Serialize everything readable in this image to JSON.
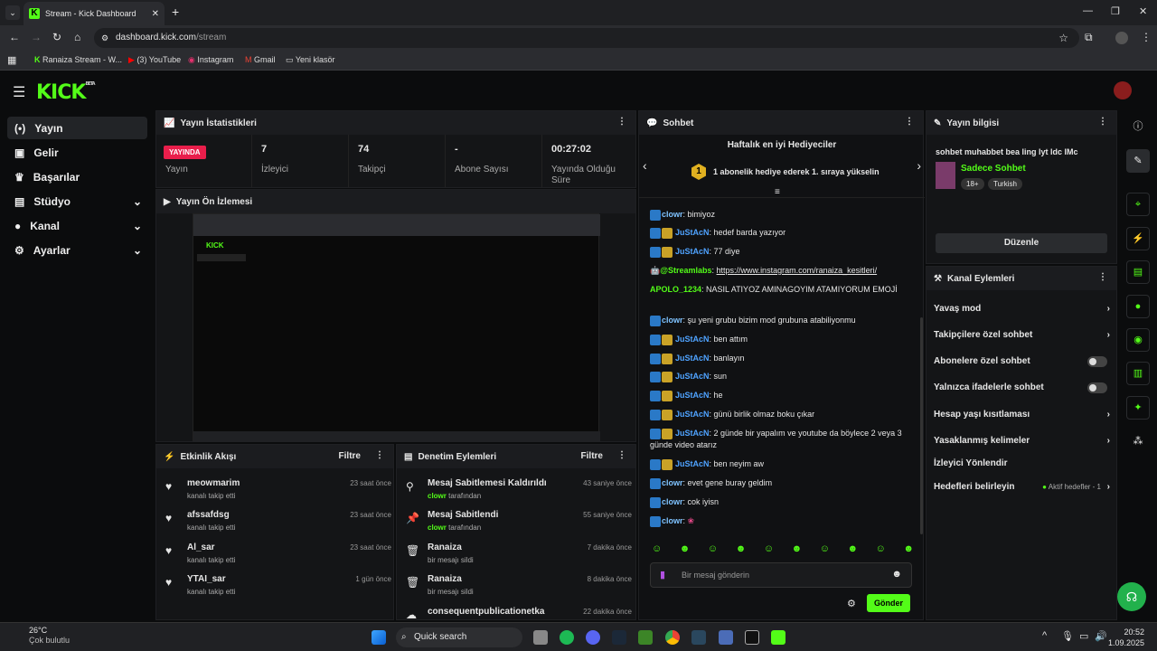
{
  "browser": {
    "tab_title": "Stream - Kick Dashboard",
    "url_host": "dashboard.kick.com",
    "url_path": "/stream",
    "bookmarks": [
      "Ranaiza Stream - W...",
      "(3) YouTube",
      "Instagram",
      "Gmail",
      "Yeni klasör"
    ]
  },
  "brand": {
    "logo": "KICK",
    "beta": "BETA"
  },
  "sidebar": {
    "items": [
      {
        "label": "Yayın"
      },
      {
        "label": "Gelir"
      },
      {
        "label": "Başarılar"
      },
      {
        "label": "Stüdyo"
      },
      {
        "label": "Kanal"
      },
      {
        "label": "Ayarlar"
      }
    ]
  },
  "stats": {
    "title": "Yayın İstatistikleri",
    "live_badge": "YAYINDA",
    "live_label": "Yayın",
    "items": [
      {
        "value": "7",
        "label": "İzleyici"
      },
      {
        "value": "74",
        "label": "Takipçi"
      },
      {
        "value": "-",
        "label": "Abone Sayısı"
      },
      {
        "value": "00:27:02",
        "label": "Yayında Olduğu Süre"
      }
    ]
  },
  "preview": {
    "title": "Yayın Ön İzlemesi"
  },
  "activity": {
    "title": "Etkinlik Akışı",
    "filter": "Filtre",
    "events": [
      {
        "name": "meowmarim",
        "sub": "kanalı takip etti",
        "time": "23 saat önce"
      },
      {
        "name": "afssafdsg",
        "sub": "kanalı takip etti",
        "time": "23 saat önce"
      },
      {
        "name": "Al_sar",
        "sub": "kanalı takip etti",
        "time": "23 saat önce"
      },
      {
        "name": "YTAI_sar",
        "sub": "kanalı takip etti",
        "time": "1 gün önce"
      }
    ]
  },
  "moderation": {
    "title": "Denetim Eylemleri",
    "filter": "Filtre",
    "events": [
      {
        "name": "Mesaj Sabitlemesi Kaldırıldı",
        "user": "clowr",
        "suffix": "tarafından",
        "time": "43 saniye önce"
      },
      {
        "name": "Mesaj Sabitlendi",
        "user": "clowr",
        "suffix": "tarafından",
        "time": "55 saniye önce"
      },
      {
        "name": "Ranaiza",
        "user": "",
        "suffix": "bir mesajı sildi",
        "time": "7 dakika önce"
      },
      {
        "name": "Ranaiza",
        "user": "",
        "suffix": "bir mesajı sildi",
        "time": "8 dakika önce"
      },
      {
        "name": "consequentpublicationetka",
        "user": "",
        "suffix": "",
        "time": "22 dakika önce"
      }
    ]
  },
  "chat": {
    "title": "Sohbet",
    "gifter_title": "Haftalık en iyi Hediyeciler",
    "gifter_rank": "1",
    "gifter_text": "1 abonelik hediye ederek 1. sıraya yükselin",
    "messages": [
      {
        "user": "clowr",
        "text": "bimiyoz"
      },
      {
        "user": "JuStAcN",
        "text": "hedef barda yazıyor"
      },
      {
        "user": "JuStAcN",
        "text": "77 diye"
      },
      {
        "user": "@Streamlabs",
        "text": "https://www.instagram.com/ranaiza_kesitleri/"
      },
      {
        "user": "APOLO_1234",
        "text": "NASIL ATIYOZ AMINAGOYIM ATAMIYORUM EMOJİ"
      },
      {
        "user": "clowr",
        "text": "şu yeni grubu bizim mod grubuna atabiliyonmu"
      },
      {
        "user": "JuStAcN",
        "text": "ben attım"
      },
      {
        "user": "JuStAcN",
        "text": "banlayın"
      },
      {
        "user": "JuStAcN",
        "text": "sun"
      },
      {
        "user": "JuStAcN",
        "text": "he"
      },
      {
        "user": "JuStAcN",
        "text": "günü birlik olmaz boku çıkar"
      },
      {
        "user": "JuStAcN",
        "text": "2 günde bir yapalım ve youtube da böylece 2 veya 3 günde video atarız"
      },
      {
        "user": "JuStAcN",
        "text": "ben neyim aw"
      },
      {
        "user": "clowr",
        "text": "evet gene buray geldim"
      },
      {
        "user": "clowr",
        "text": "cok iyisn"
      },
      {
        "user": "clowr",
        "text": ""
      }
    ],
    "input_placeholder": "Bir mesaj gönderin",
    "send": "Gönder"
  },
  "stream_info": {
    "title": "Yayın bilgisi",
    "stream_title": "sohbet muhabbet bea ling lyt ldc IMc",
    "category": "Sadece Sohbet",
    "tags": [
      "18+",
      "Turkish"
    ],
    "edit": "Düzenle"
  },
  "channel_actions": {
    "title": "Kanal Eylemleri",
    "items": [
      {
        "label": "Yavaş mod"
      },
      {
        "label": "Takipçilere özel sohbet"
      },
      {
        "label": "Abonelere özel sohbet"
      },
      {
        "label": "Yalnızca ifadelerle sohbet"
      },
      {
        "label": "Hesap yaşı kısıtlaması"
      },
      {
        "label": "Yasaklanmış kelimeler"
      },
      {
        "label": "İzleyici Yönlendir"
      },
      {
        "label": "Hedefleri belirleyin"
      }
    ],
    "goal_status": "Aktif hedefler - 1"
  },
  "taskbar": {
    "weather_temp": "26°C",
    "weather_text": "Çok bulutlu",
    "search": "Quick search",
    "time": "20:52",
    "date": "1.09.2025"
  },
  "colors": {
    "accent": "#53fc18",
    "live": "#e91e4b"
  }
}
